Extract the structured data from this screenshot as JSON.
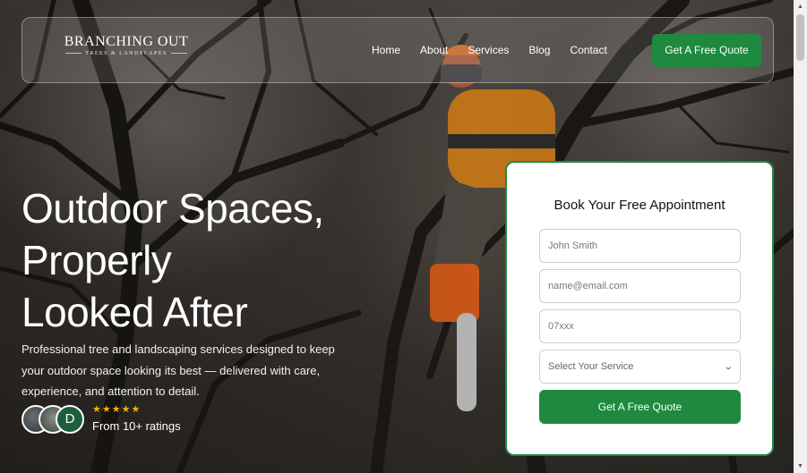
{
  "header": {
    "logo_name": "BRANCHING OUT",
    "logo_tagline": "TREES & LANDSCAPES",
    "nav": [
      {
        "label": "Home"
      },
      {
        "label": "About"
      },
      {
        "label": "Services"
      },
      {
        "label": "Blog"
      },
      {
        "label": "Contact"
      }
    ],
    "cta_label": "Get A Free Quote"
  },
  "hero": {
    "headline_lines": [
      "Outdoor Spaces,",
      "Properly",
      "Looked After"
    ],
    "subcopy": "Professional tree and landscaping services designed to keep your outdoor space looking its best — delivered with care, experience, and attention to detail.",
    "avatar_initial": "D",
    "stars": "★★★★★",
    "star_count": 5,
    "ratings_text": "From 10+ ratings"
  },
  "booking": {
    "title": "Book Your Free Appointment",
    "name_placeholder": "John Smith",
    "email_placeholder": "name@email.com",
    "phone_placeholder": "07xxx",
    "service_select_label": "Select Your Service",
    "submit_label": "Get A Free Quote"
  },
  "icons": {
    "chevron": "chevron-down-icon",
    "star": "star-icon",
    "scroll_up": "scroll-up-icon",
    "scroll_down": "scroll-down-icon"
  },
  "colors": {
    "accent_green": "#1f8a3f",
    "star_gold": "#f5b400",
    "avatar_green": "#1d5e3b"
  }
}
